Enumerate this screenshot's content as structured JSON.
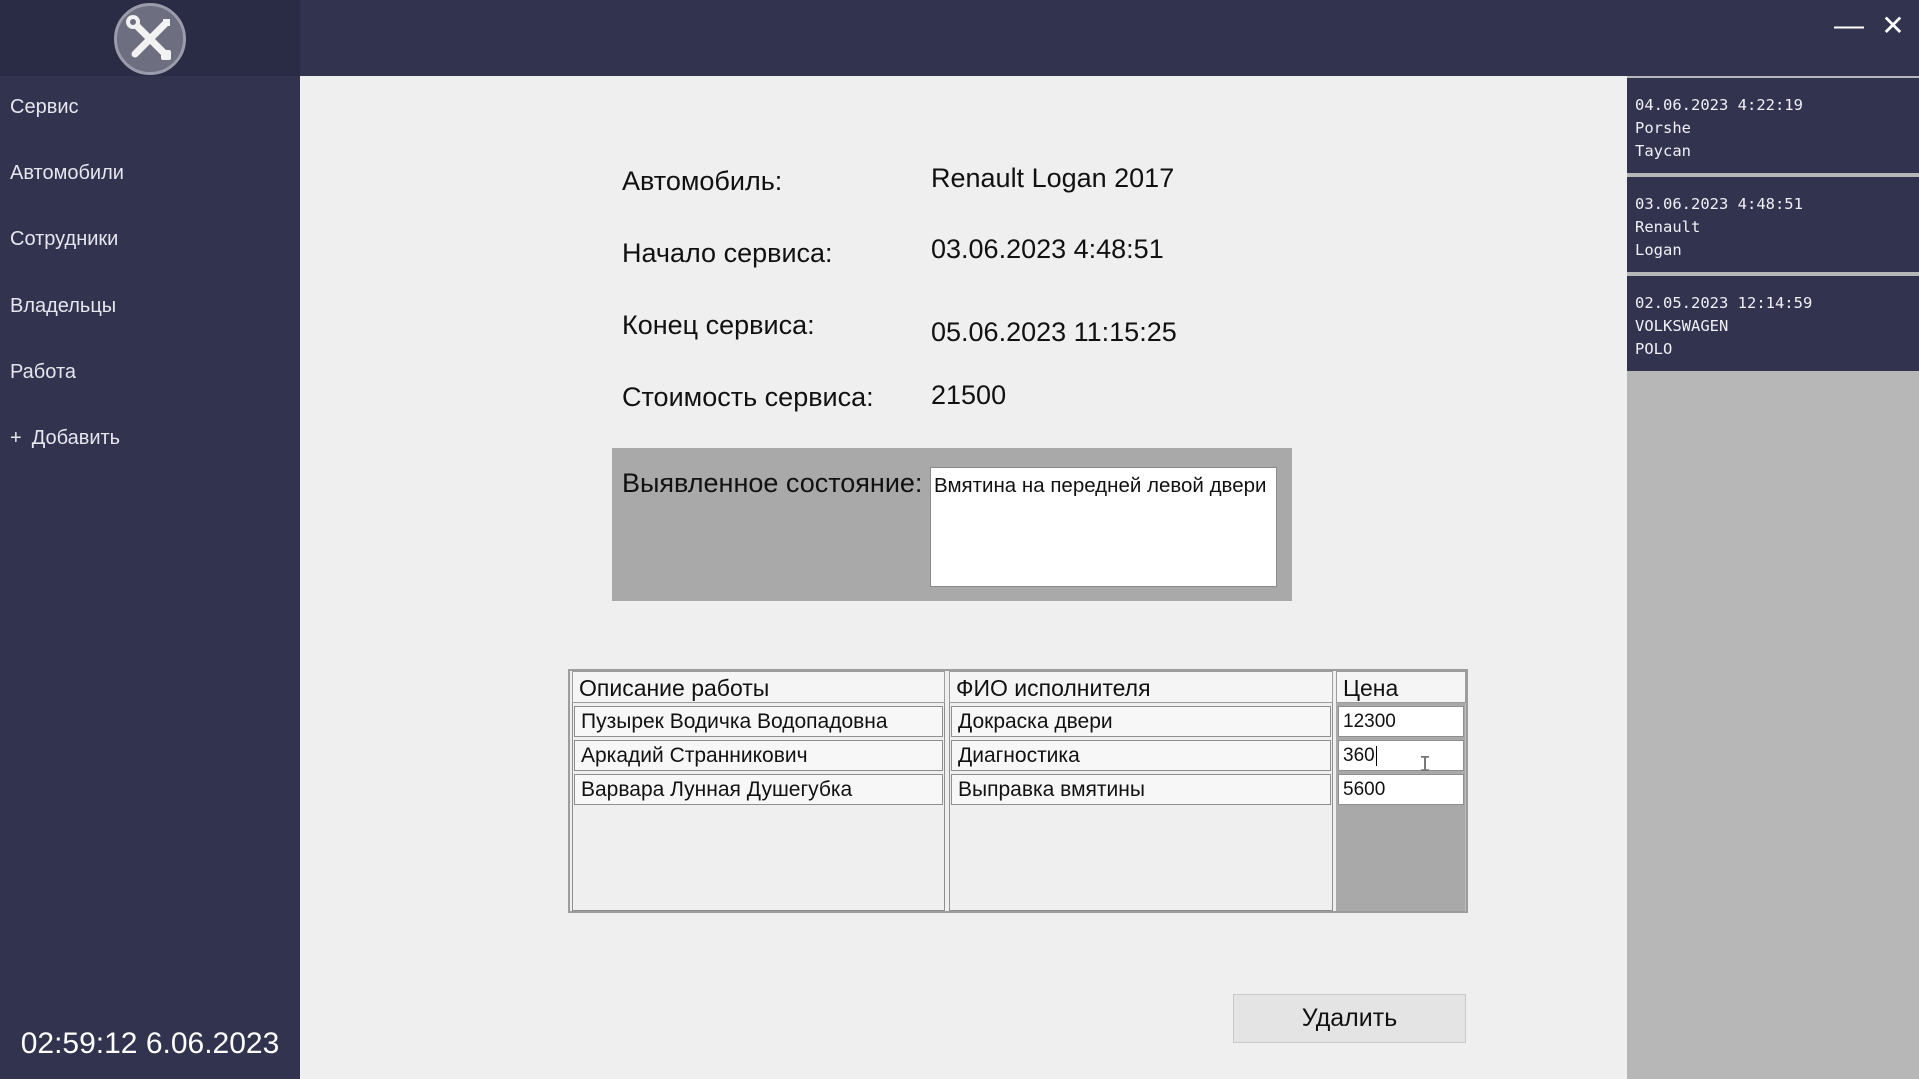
{
  "sidebar": {
    "items": [
      {
        "label": "Сервис"
      },
      {
        "label": "Автомобили"
      },
      {
        "label": "Сотрудники"
      },
      {
        "label": "Владельцы"
      },
      {
        "label": "Работа"
      },
      {
        "label": "Добавить",
        "prefix": "+"
      }
    ],
    "clock": "02:59:12 6.06.2023",
    "logo_icon": "tools-icon"
  },
  "window": {
    "minimize": "—",
    "close": "✕"
  },
  "form": {
    "car_label": "Автомобиль:",
    "car_value": "Renault Logan 2017",
    "start_label": "Начало сервиса:",
    "start_value": "03.06.2023 4:48:51",
    "end_label": "Конец сервиса:",
    "end_value": "05.06.2023 11:15:25",
    "cost_label": "Стоимость сервиса:",
    "cost_value": "21500",
    "condition_label": "Выявленное состояние:",
    "condition_value": "Вмятина на передней левой двери"
  },
  "table": {
    "headers": [
      "Описание работы",
      "ФИО исполнителя",
      "Цена"
    ],
    "rows": [
      {
        "c1": "Пузырек Водичка Водопадовна",
        "c2": "Докраска двери",
        "price": "12300"
      },
      {
        "c1": "Аркадий Странникович",
        "c2": "Диагностика",
        "price": "360"
      },
      {
        "c1": "Варвара Лунная Душегубка",
        "c2": "Выправка вмятины",
        "price": "5600"
      }
    ]
  },
  "actions": {
    "delete_label": "Удалить"
  },
  "history": [
    {
      "date": "04.06.2023 4:22:19",
      "make": "Porshe",
      "model": "Taycan"
    },
    {
      "date": "03.06.2023 4:48:51",
      "make": "Renault",
      "model": "Logan"
    },
    {
      "date": "02.05.2023 12:14:59",
      "make": "VOLKSWAGEN",
      "model": "POLO"
    }
  ],
  "colors": {
    "sidebar": "#32334f",
    "logo_bg": "#2a2b44",
    "history_bg": "#b7b7b7",
    "main_bg": "#efefef",
    "panel_gray": "#a9a9a9"
  }
}
